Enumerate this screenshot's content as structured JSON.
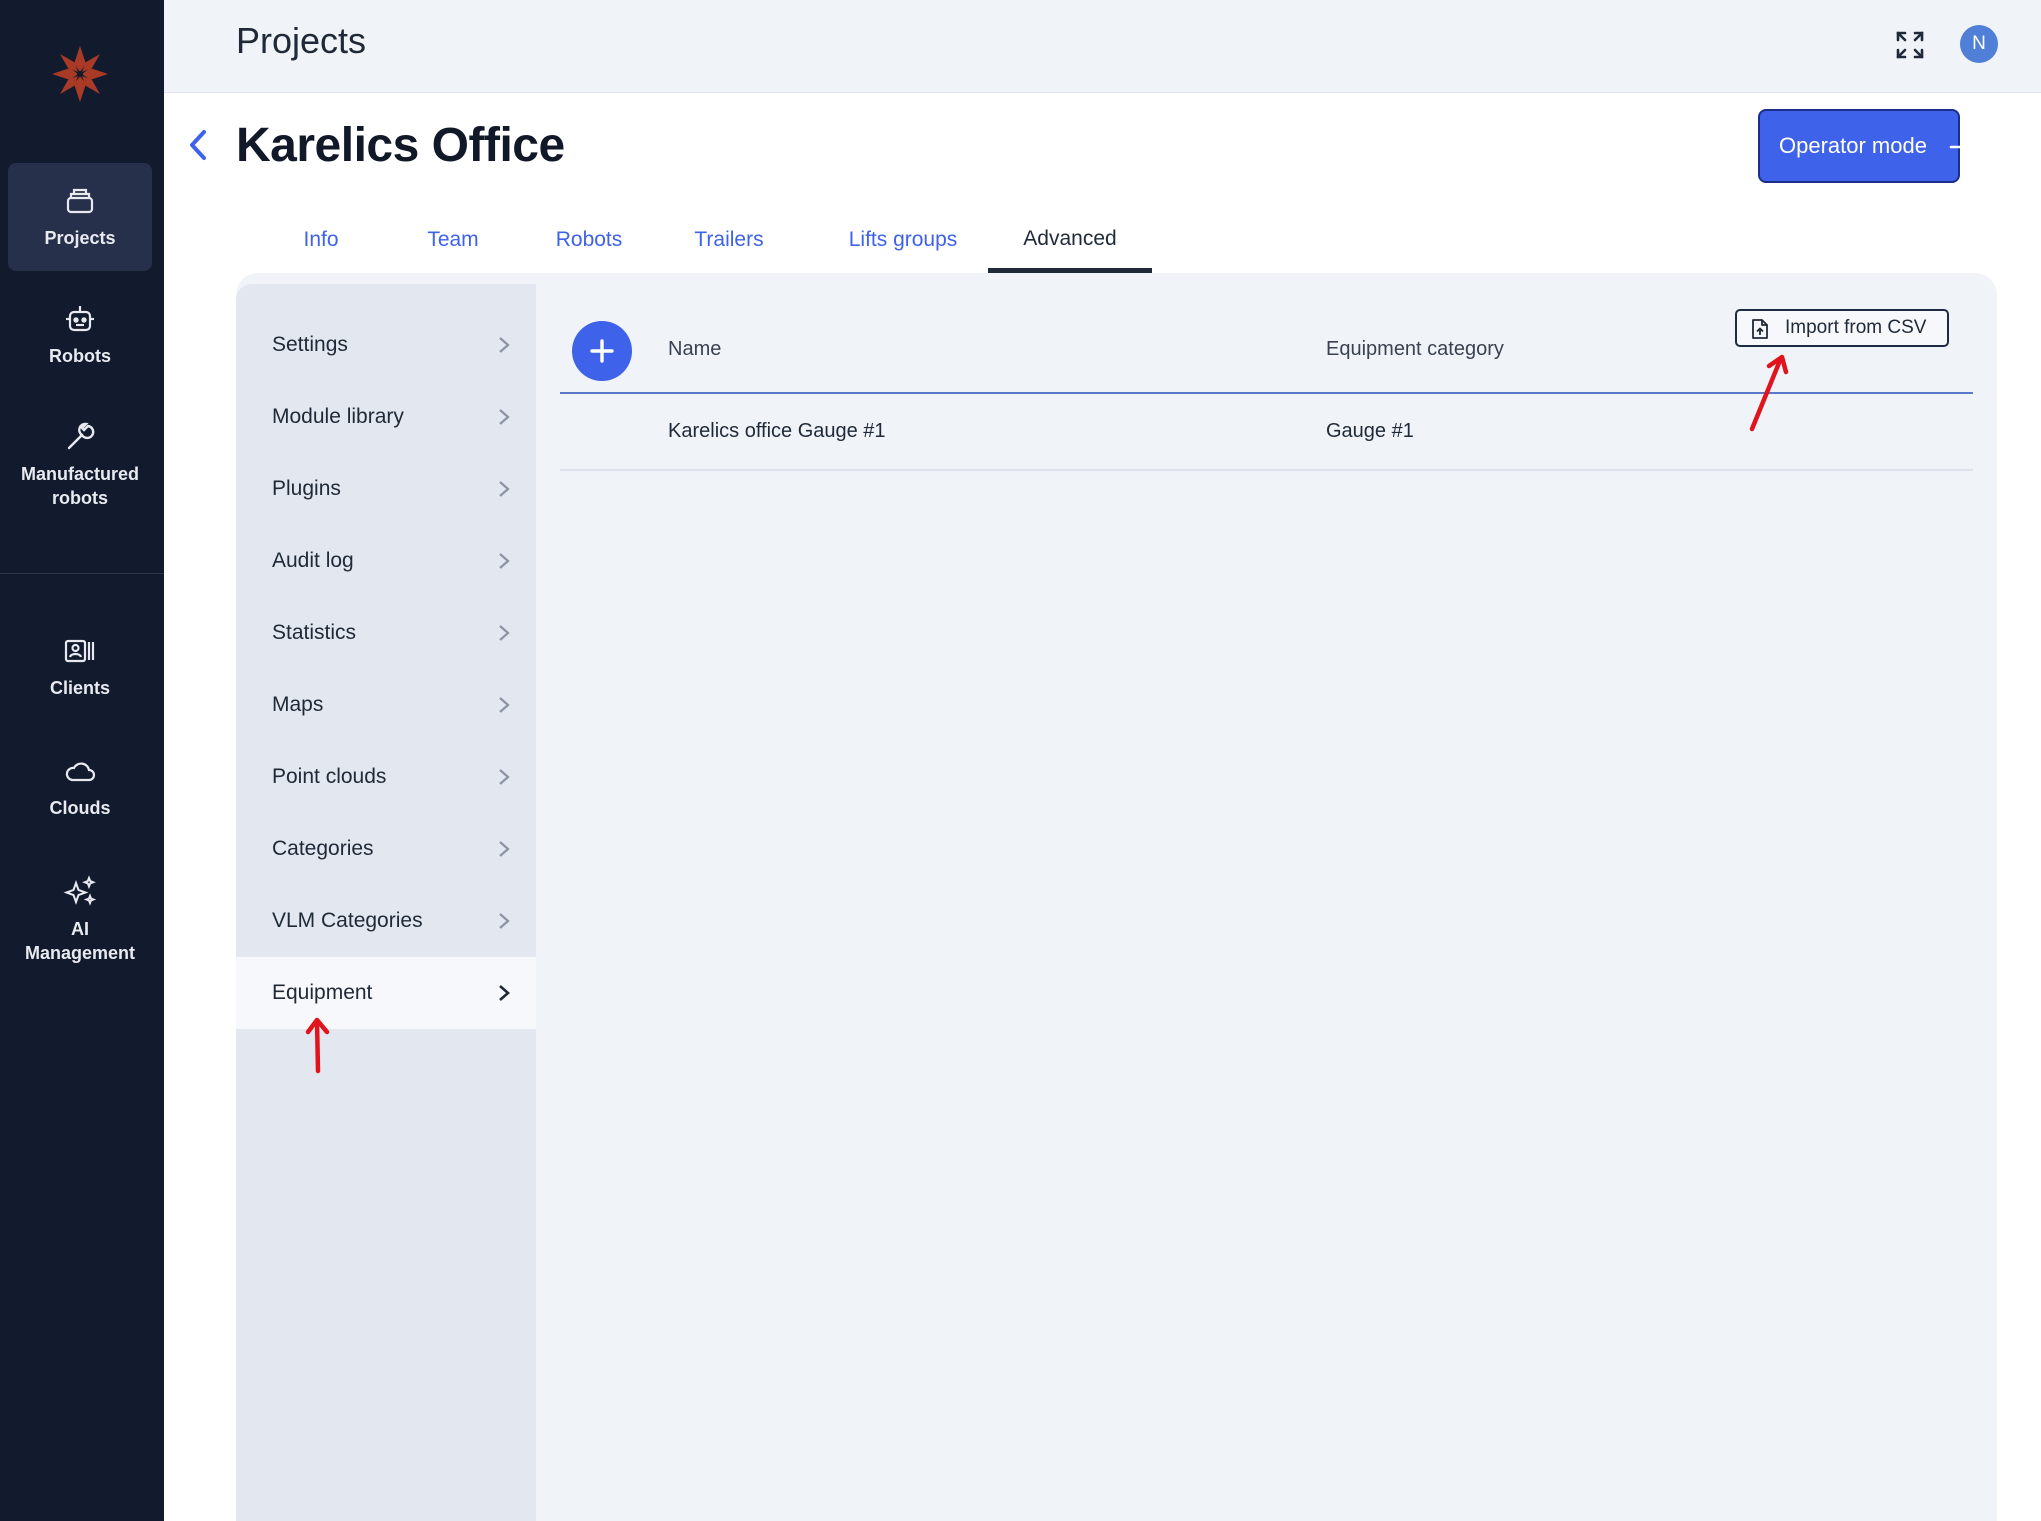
{
  "app": {
    "title": "Projects"
  },
  "user": {
    "initial": "N"
  },
  "rail": {
    "items": [
      {
        "label": "Projects",
        "icon": "projects-icon",
        "active": true
      },
      {
        "label": "Robots",
        "icon": "robot-icon",
        "active": false
      },
      {
        "label": "Manufactured robots",
        "icon": "wrench-icon",
        "active": false
      },
      {
        "label": "Clients",
        "icon": "clients-icon",
        "active": false
      },
      {
        "label": "Clouds",
        "icon": "cloud-icon",
        "active": false
      },
      {
        "label": "AI Management",
        "icon": "sparkle-icon",
        "active": false
      }
    ]
  },
  "header": {
    "title": "Karelics Office",
    "operator_button": "Operator mode"
  },
  "tabs": [
    {
      "label": "Info",
      "active": false
    },
    {
      "label": "Team",
      "active": false
    },
    {
      "label": "Robots",
      "active": false
    },
    {
      "label": "Trailers",
      "active": false
    },
    {
      "label": "Lifts groups",
      "active": false
    },
    {
      "label": "Advanced",
      "active": true
    }
  ],
  "subnav": {
    "items": [
      {
        "label": "Settings",
        "active": false
      },
      {
        "label": "Module library",
        "active": false
      },
      {
        "label": "Plugins",
        "active": false
      },
      {
        "label": "Audit log",
        "active": false
      },
      {
        "label": "Statistics",
        "active": false
      },
      {
        "label": "Maps",
        "active": false
      },
      {
        "label": "Point clouds",
        "active": false
      },
      {
        "label": "Categories",
        "active": false
      },
      {
        "label": "VLM Categories",
        "active": false
      },
      {
        "label": "Equipment",
        "active": true
      }
    ]
  },
  "equipment": {
    "import_button": "Import from CSV",
    "columns": [
      "Name",
      "Equipment category"
    ],
    "rows": [
      [
        "Karelics office Gauge #1",
        "Gauge #1"
      ]
    ]
  },
  "colors": {
    "accent": "#3f62ea",
    "rail_bg": "#121a2e",
    "annotation": "#e0141c"
  }
}
